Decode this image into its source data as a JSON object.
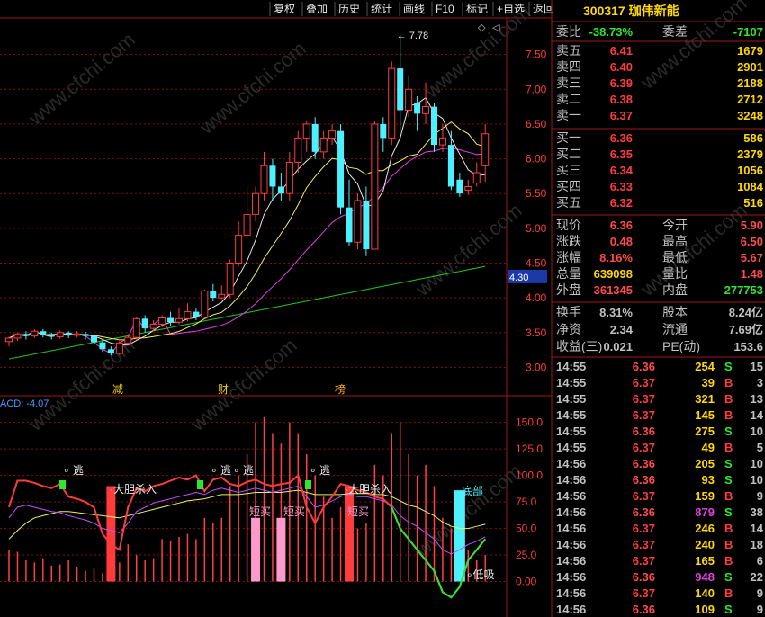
{
  "toolbar": {
    "buttons": [
      "复权",
      "叠加",
      "历史",
      "统计",
      "画线",
      "F10",
      "标记",
      "+自选",
      "返回"
    ]
  },
  "stock": {
    "code": "300317",
    "name": "珈伟新能"
  },
  "quote": {
    "weibi_label": "委比",
    "weibi": "-38.73%",
    "weicha_label": "委差",
    "weicha": "-7107",
    "sells": [
      {
        "label": "卖五",
        "price": "6.41",
        "vol": "1679"
      },
      {
        "label": "卖四",
        "price": "6.40",
        "vol": "2901"
      },
      {
        "label": "卖三",
        "price": "6.39",
        "vol": "2188"
      },
      {
        "label": "卖二",
        "price": "6.38",
        "vol": "2712"
      },
      {
        "label": "卖一",
        "price": "6.37",
        "vol": "3248"
      }
    ],
    "buys": [
      {
        "label": "买一",
        "price": "6.36",
        "vol": "586"
      },
      {
        "label": "买二",
        "price": "6.35",
        "vol": "2379"
      },
      {
        "label": "买三",
        "price": "6.34",
        "vol": "1056"
      },
      {
        "label": "买四",
        "price": "6.33",
        "vol": "1084"
      },
      {
        "label": "买五",
        "price": "6.32",
        "vol": "516"
      }
    ],
    "stats": [
      {
        "l1": "现价",
        "v1": "6.36",
        "c1": "#ff4a4a",
        "l2": "今开",
        "v2": "5.90",
        "c2": "#ff4a4a"
      },
      {
        "l1": "涨跌",
        "v1": "0.48",
        "c1": "#ff4a4a",
        "l2": "最高",
        "v2": "6.50",
        "c2": "#ff4a4a"
      },
      {
        "l1": "涨幅",
        "v1": "8.16%",
        "c1": "#ff4a4a",
        "l2": "最低",
        "v2": "5.67",
        "c2": "#ff4a4a"
      },
      {
        "l1": "总量",
        "v1": "639098",
        "c1": "#ffd800",
        "l2": "量比",
        "v2": "1.48",
        "c2": "#ff4a4a"
      },
      {
        "l1": "外盘",
        "v1": "361345",
        "c1": "#ff4a4a",
        "l2": "内盘",
        "v2": "277753",
        "c2": "#2ee62e"
      }
    ],
    "stats2": [
      {
        "l1": "换手",
        "v1": "8.31%",
        "l2": "股本",
        "v2": "8.24亿"
      },
      {
        "l1": "净资",
        "v1": "2.34",
        "l2": "流通",
        "v2": "7.69亿"
      },
      {
        "l1": "收益(三)",
        "v1": "0.021",
        "l2": "PE(动)",
        "v2": "153.6"
      }
    ],
    "ticks": [
      {
        "time": "14:55",
        "price": "6.36",
        "vol": "254",
        "bs": "S",
        "n": "15"
      },
      {
        "time": "14:55",
        "price": "6.37",
        "vol": "39",
        "bs": "B",
        "n": "3"
      },
      {
        "time": "14:55",
        "price": "6.37",
        "vol": "321",
        "bs": "B",
        "n": "13"
      },
      {
        "time": "14:55",
        "price": "6.37",
        "vol": "145",
        "bs": "B",
        "n": "14"
      },
      {
        "time": "14:55",
        "price": "6.36",
        "vol": "275",
        "bs": "S",
        "n": "10"
      },
      {
        "time": "14:55",
        "price": "6.37",
        "vol": "49",
        "bs": "B",
        "n": "5"
      },
      {
        "time": "14:56",
        "price": "6.36",
        "vol": "205",
        "bs": "S",
        "n": "10"
      },
      {
        "time": "14:56",
        "price": "6.36",
        "vol": "93",
        "bs": "S",
        "n": "10"
      },
      {
        "time": "14:56",
        "price": "6.37",
        "vol": "159",
        "bs": "B",
        "n": "9"
      },
      {
        "time": "14:56",
        "price": "6.36",
        "vol": "879",
        "bs": "S",
        "n": "38"
      },
      {
        "time": "14:56",
        "price": "6.37",
        "vol": "246",
        "bs": "B",
        "n": "14"
      },
      {
        "time": "14:56",
        "price": "6.37",
        "vol": "240",
        "bs": "B",
        "n": "18"
      },
      {
        "time": "14:56",
        "price": "6.37",
        "vol": "165",
        "bs": "B",
        "n": "6"
      },
      {
        "time": "14:56",
        "price": "6.36",
        "vol": "948",
        "bs": "S",
        "n": "22"
      },
      {
        "time": "14:56",
        "price": "6.37",
        "vol": "140",
        "bs": "B",
        "n": "9"
      },
      {
        "time": "14:56",
        "price": "6.36",
        "vol": "109",
        "bs": "S",
        "n": "9"
      }
    ]
  },
  "chart_data": [
    {
      "type": "candlestick",
      "y_ticks": [
        "7.50",
        "7.00",
        "6.50",
        "6.00",
        "5.50",
        "5.00",
        "4.50",
        "4.00",
        "3.50",
        "3.00"
      ],
      "ylim": [
        2.85,
        8.0
      ],
      "high_marker": "7.78",
      "current_price_marker": "4.30",
      "candles": [
        [
          3.37,
          3.42,
          3.44,
          3.3
        ],
        [
          3.42,
          3.48,
          3.5,
          3.38
        ],
        [
          3.48,
          3.45,
          3.52,
          3.4
        ],
        [
          3.45,
          3.52,
          3.55,
          3.42
        ],
        [
          3.52,
          3.47,
          3.55,
          3.43
        ],
        [
          3.47,
          3.44,
          3.5,
          3.4
        ],
        [
          3.44,
          3.5,
          3.53,
          3.41
        ],
        [
          3.5,
          3.46,
          3.52,
          3.42
        ],
        [
          3.46,
          3.48,
          3.52,
          3.43
        ],
        [
          3.48,
          3.45,
          3.51,
          3.4
        ],
        [
          3.45,
          3.36,
          3.48,
          3.3
        ],
        [
          3.36,
          3.26,
          3.4,
          3.22
        ],
        [
          3.26,
          3.2,
          3.3,
          3.17
        ],
        [
          3.2,
          3.35,
          3.4,
          3.18
        ],
        [
          3.35,
          3.43,
          3.48,
          3.32
        ],
        [
          3.43,
          3.7,
          3.72,
          3.4
        ],
        [
          3.7,
          3.56,
          3.75,
          3.5
        ],
        [
          3.56,
          3.62,
          3.68,
          3.52
        ],
        [
          3.62,
          3.71,
          3.75,
          3.58
        ],
        [
          3.71,
          3.65,
          3.8,
          3.6
        ],
        [
          3.65,
          3.7,
          3.86,
          3.62
        ],
        [
          3.7,
          3.8,
          3.92,
          3.66
        ],
        [
          3.8,
          3.72,
          3.85,
          3.68
        ],
        [
          3.72,
          4.1,
          4.12,
          3.7
        ],
        [
          4.1,
          4.0,
          4.2,
          3.95
        ],
        [
          4.0,
          4.05,
          4.18,
          3.98
        ],
        [
          4.05,
          4.5,
          4.55,
          4.0
        ],
        [
          4.5,
          4.9,
          5.1,
          4.45
        ],
        [
          4.9,
          5.2,
          5.6,
          4.85
        ],
        [
          5.2,
          5.5,
          5.6,
          5.1
        ],
        [
          5.5,
          5.9,
          6.1,
          5.4
        ],
        [
          5.9,
          5.6,
          6.0,
          5.4
        ],
        [
          5.6,
          5.5,
          5.8,
          5.4
        ],
        [
          5.5,
          5.95,
          6.1,
          5.4
        ],
        [
          5.95,
          6.3,
          6.4,
          5.8
        ],
        [
          6.3,
          6.5,
          6.55,
          6.1
        ],
        [
          6.5,
          6.1,
          6.6,
          6.0
        ],
        [
          6.1,
          6.3,
          6.4,
          6.0
        ],
        [
          6.3,
          6.4,
          6.5,
          6.2
        ],
        [
          6.4,
          5.3,
          6.5,
          5.2
        ],
        [
          5.3,
          4.8,
          5.7,
          4.75
        ],
        [
          4.8,
          5.4,
          5.5,
          4.7
        ],
        [
          5.4,
          4.7,
          5.6,
          4.6
        ],
        [
          4.7,
          6.5,
          6.55,
          4.7
        ],
        [
          6.5,
          6.3,
          6.6,
          6.1
        ],
        [
          6.3,
          7.3,
          7.4,
          6.2
        ],
        [
          7.3,
          6.7,
          7.78,
          6.4
        ],
        [
          6.7,
          7.0,
          7.2,
          6.6
        ],
        [
          6.8,
          6.65,
          6.9,
          6.4
        ],
        [
          6.65,
          6.75,
          7.1,
          6.5
        ],
        [
          6.75,
          6.2,
          6.8,
          6.1
        ],
        [
          6.2,
          6.3,
          6.5,
          6.1
        ],
        [
          6.2,
          5.6,
          6.4,
          5.55
        ],
        [
          5.7,
          5.5,
          5.8,
          5.45
        ],
        [
          5.55,
          5.6,
          5.7,
          5.48
        ],
        [
          5.65,
          5.8,
          5.95,
          5.6
        ],
        [
          5.9,
          6.36,
          6.5,
          5.67
        ]
      ],
      "labels": [
        "减",
        "财",
        "榜"
      ]
    },
    {
      "type": "indicator",
      "title": "ACD: -4.07",
      "y_ticks": [
        "150.0",
        "125.0",
        "100.0",
        "75.0",
        "50.0",
        "25.0",
        "0.00"
      ],
      "ylim": [
        -25,
        165
      ],
      "annotations": [
        "逃",
        "大胆杀入",
        "逃",
        "逃",
        "短买",
        "短买",
        "逃",
        "大胆杀入",
        "短买",
        "底部",
        "低吸"
      ]
    }
  ]
}
